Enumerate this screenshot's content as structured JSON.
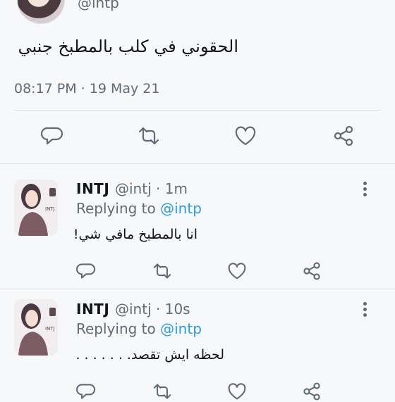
{
  "main_tweet": {
    "handle": "@intp",
    "text": "الحقوني في كلب بالمطبخ جنبي",
    "timestamp": "08:17 PM · 19 May 21",
    "actions": [
      "reply-icon",
      "retweet-icon",
      "like-icon",
      "share-icon"
    ]
  },
  "replies": [
    {
      "name": "INTJ",
      "handle": "@intj",
      "time": "· 1m",
      "replying_prefix": "Replying to",
      "replying_handle": "@intp",
      "text": "انا بالمطبخ مافي شي!"
    },
    {
      "name": "INTJ",
      "handle": "@intj",
      "time": "· 10s",
      "replying_prefix": "Replying to",
      "replying_handle": "@intp",
      "text": "لحظه ايش تقصد. . . . . . ."
    }
  ],
  "colors": {
    "link_blue": "#2d9be0",
    "secondary_text": "#5f6b76",
    "background": "#f7f8f9"
  }
}
